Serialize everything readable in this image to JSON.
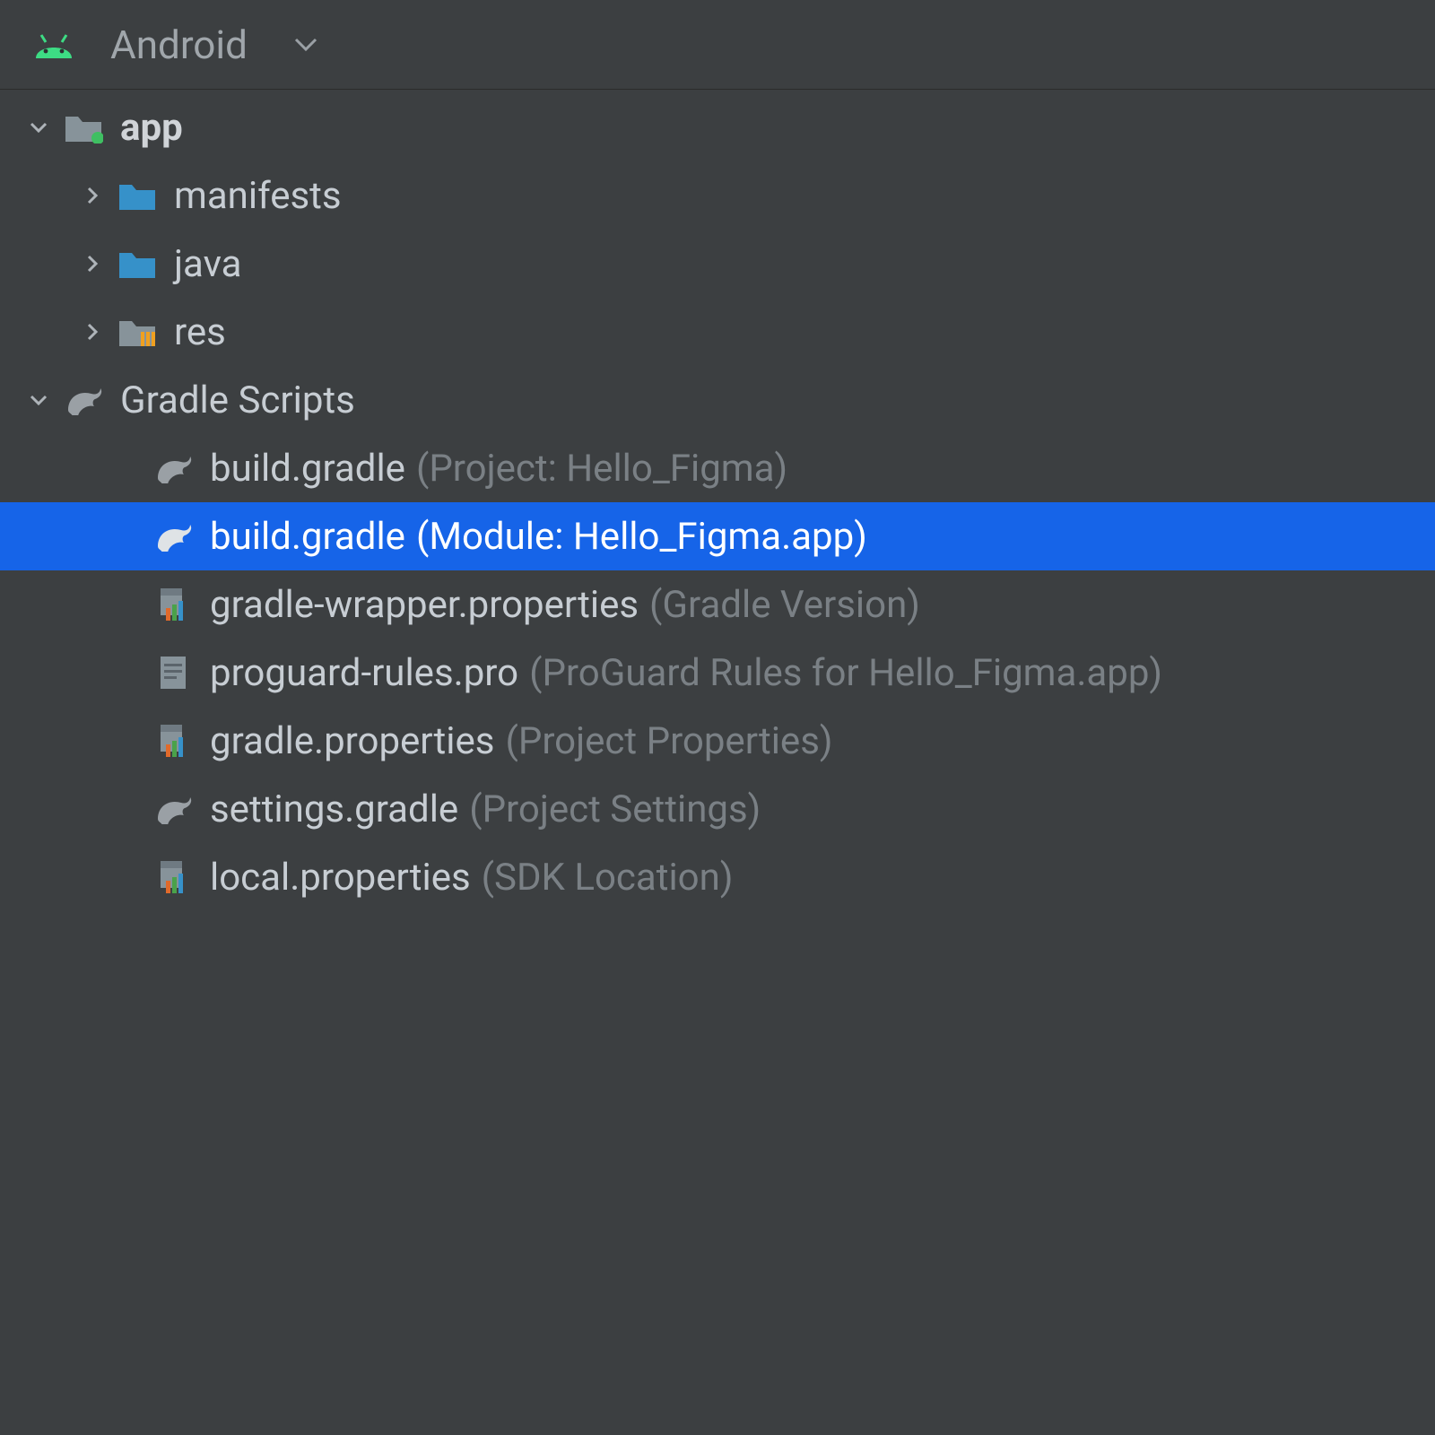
{
  "toolbar": {
    "view_label": "Android"
  },
  "tree": {
    "app": {
      "label": "app",
      "children": {
        "manifests": "manifests",
        "java": "java",
        "res": "res"
      }
    },
    "gradle_scripts": {
      "label": "Gradle Scripts",
      "items": [
        {
          "name": "build.gradle",
          "hint": "(Project: Hello_Figma)",
          "icon": "gradle",
          "selected": false
        },
        {
          "name": "build.gradle",
          "hint": "(Module: Hello_Figma.app)",
          "icon": "gradle",
          "selected": true
        },
        {
          "name": "gradle-wrapper.properties",
          "hint": "(Gradle Version)",
          "icon": "properties",
          "selected": false
        },
        {
          "name": "proguard-rules.pro",
          "hint": "(ProGuard Rules for Hello_Figma.app)",
          "icon": "text",
          "selected": false
        },
        {
          "name": "gradle.properties",
          "hint": "(Project Properties)",
          "icon": "properties",
          "selected": false
        },
        {
          "name": "settings.gradle",
          "hint": "(Project Settings)",
          "icon": "gradle",
          "selected": false
        },
        {
          "name": "local.properties",
          "hint": "(SDK Location)",
          "icon": "properties",
          "selected": false
        }
      ]
    }
  },
  "colors": {
    "selected_bg": "#1664e8",
    "panel_bg": "#3c3f41",
    "folder_blue": "#3691c9",
    "folder_gray": "#87939a",
    "android_green": "#3ddc84"
  }
}
